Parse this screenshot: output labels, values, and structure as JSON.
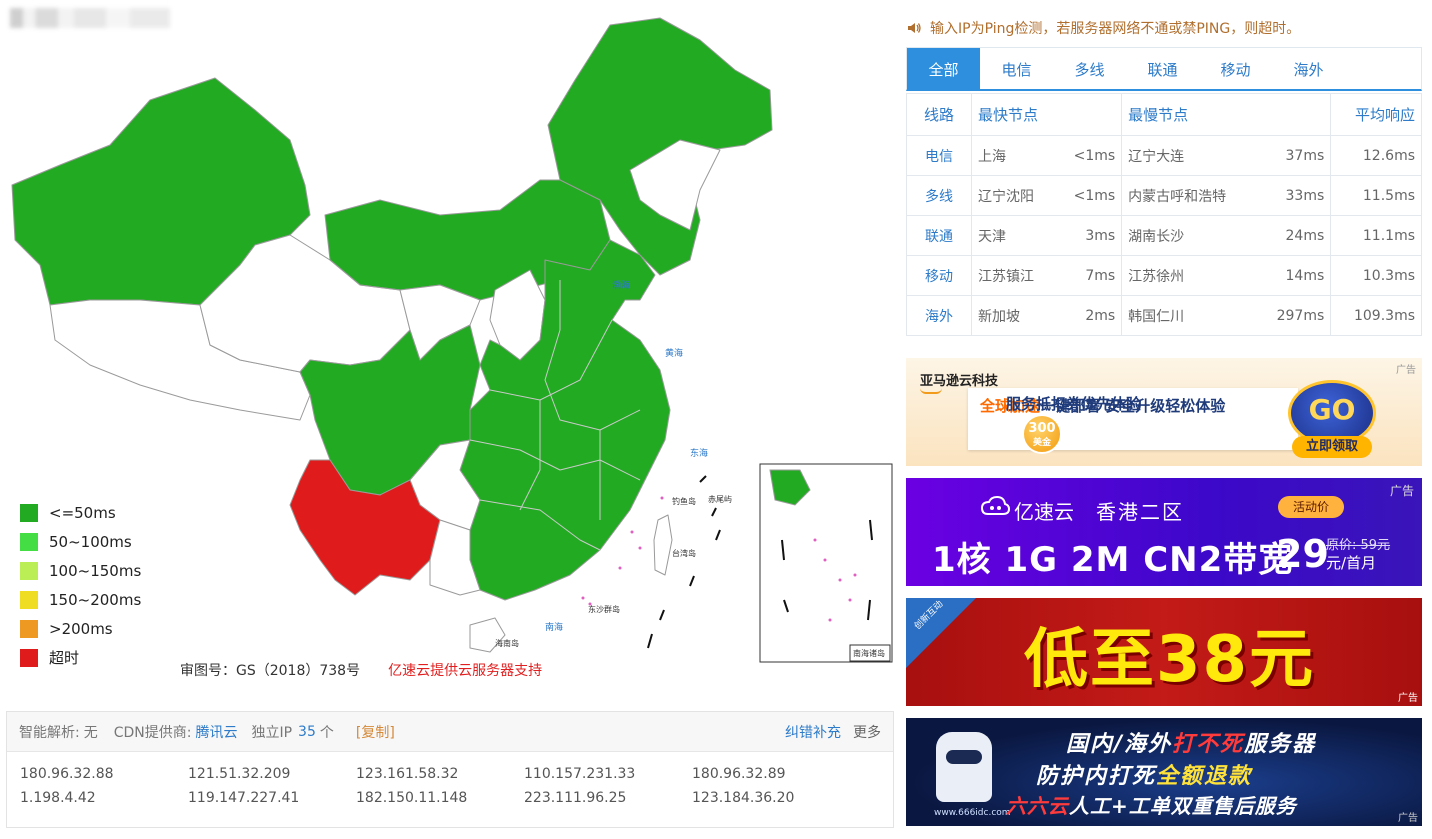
{
  "map": {
    "legend": [
      {
        "label": "<=50ms",
        "color": "#22aa22"
      },
      {
        "label": "50~100ms",
        "color": "#44dd44"
      },
      {
        "label": "100~150ms",
        "color": "#bbee55"
      },
      {
        "label": "150~200ms",
        "color": "#eedd22"
      },
      {
        "label": ">200ms",
        "color": "#ee9922"
      },
      {
        "label": "超时",
        "color": "#e01b1b"
      }
    ],
    "approval": "审图号：GS（2018）738号",
    "support": "亿速云提供云服务器支持",
    "inset_label": "南海诸岛",
    "sea_labels": [
      "渤海",
      "黄海",
      "东海",
      "南海"
    ],
    "island_labels": [
      "台湾岛",
      "钓鱼岛",
      "赤尾屿",
      "东沙群岛",
      "海南岛"
    ]
  },
  "ip_panel": {
    "resolve_label": "智能解析:",
    "resolve_value": "无",
    "cdn_label": "CDN提供商:",
    "cdn_value": "腾讯云",
    "ip_label": "独立IP",
    "ip_count": "35",
    "ip_unit": "个",
    "copy": "[复制]",
    "fix": "纠错补充",
    "more": "更多",
    "ips": [
      "180.96.32.88",
      "121.51.32.209",
      "123.161.58.32",
      "110.157.231.33",
      "180.96.32.89",
      "1.198.4.42",
      "119.147.227.41",
      "182.150.11.148",
      "223.111.96.25",
      "123.184.36.20"
    ]
  },
  "notice": "输入IP为Ping检测，若服务器网络不通或禁PING，则超时。",
  "tabs": [
    "全部",
    "电信",
    "多线",
    "联通",
    "移动",
    "海外"
  ],
  "table": {
    "headers": {
      "line": "线路",
      "fastest": "最快节点",
      "slowest": "最慢节点",
      "avg": "平均响应"
    },
    "rows": [
      {
        "line": "电信",
        "fast_node": "上海",
        "fast_ms": "<1ms",
        "slow_node": "辽宁大连",
        "slow_ms": "37ms",
        "avg": "12.6ms"
      },
      {
        "line": "多线",
        "fast_node": "辽宁沈阳",
        "fast_ms": "<1ms",
        "slow_node": "内蒙古呼和浩特",
        "slow_ms": "33ms",
        "avg": "11.5ms"
      },
      {
        "line": "联通",
        "fast_node": "天津",
        "fast_ms": "3ms",
        "slow_node": "湖南长沙",
        "slow_ms": "24ms",
        "avg": "11.1ms"
      },
      {
        "line": "移动",
        "fast_node": "江苏镇江",
        "fast_ms": "7ms",
        "slow_node": "江苏徐州",
        "slow_ms": "14ms",
        "avg": "10.3ms"
      },
      {
        "line": "海外",
        "fast_node": "新加坡",
        "fast_ms": "2ms",
        "slow_node": "韩国仁川",
        "slow_ms": "297ms",
        "avg": "109.3ms"
      }
    ]
  },
  "ads": {
    "tag": "广告",
    "ad1": {
      "brand": "亚马逊云科技",
      "hot": "全球加速",
      "line1": "一键部署  安全升级轻松体验",
      "coin_top": "300",
      "coin_bottom": "美金",
      "line2": "服务抵扣券优先体验",
      "go": "GO",
      "claim": "立即领取"
    },
    "ad2": {
      "logo": "亿速云",
      "region": "香港二区",
      "spec": "1核 1G 2M CN2带宽",
      "badge": "活动价",
      "price": "29",
      "orig": "原价: 59元",
      "unit": "元/首月"
    },
    "ad3": {
      "corner": "创新互动",
      "big": "低至38元"
    },
    "ad4": {
      "site": "www.666idc.com",
      "t1a": "国内/海外",
      "t1b": "打不死",
      "t1c": "服务器",
      "t2a": "防护内打死",
      "t2b": "全额退款",
      "t3a": "六六云",
      "t3b": "人工+工单双重售后服务"
    }
  }
}
